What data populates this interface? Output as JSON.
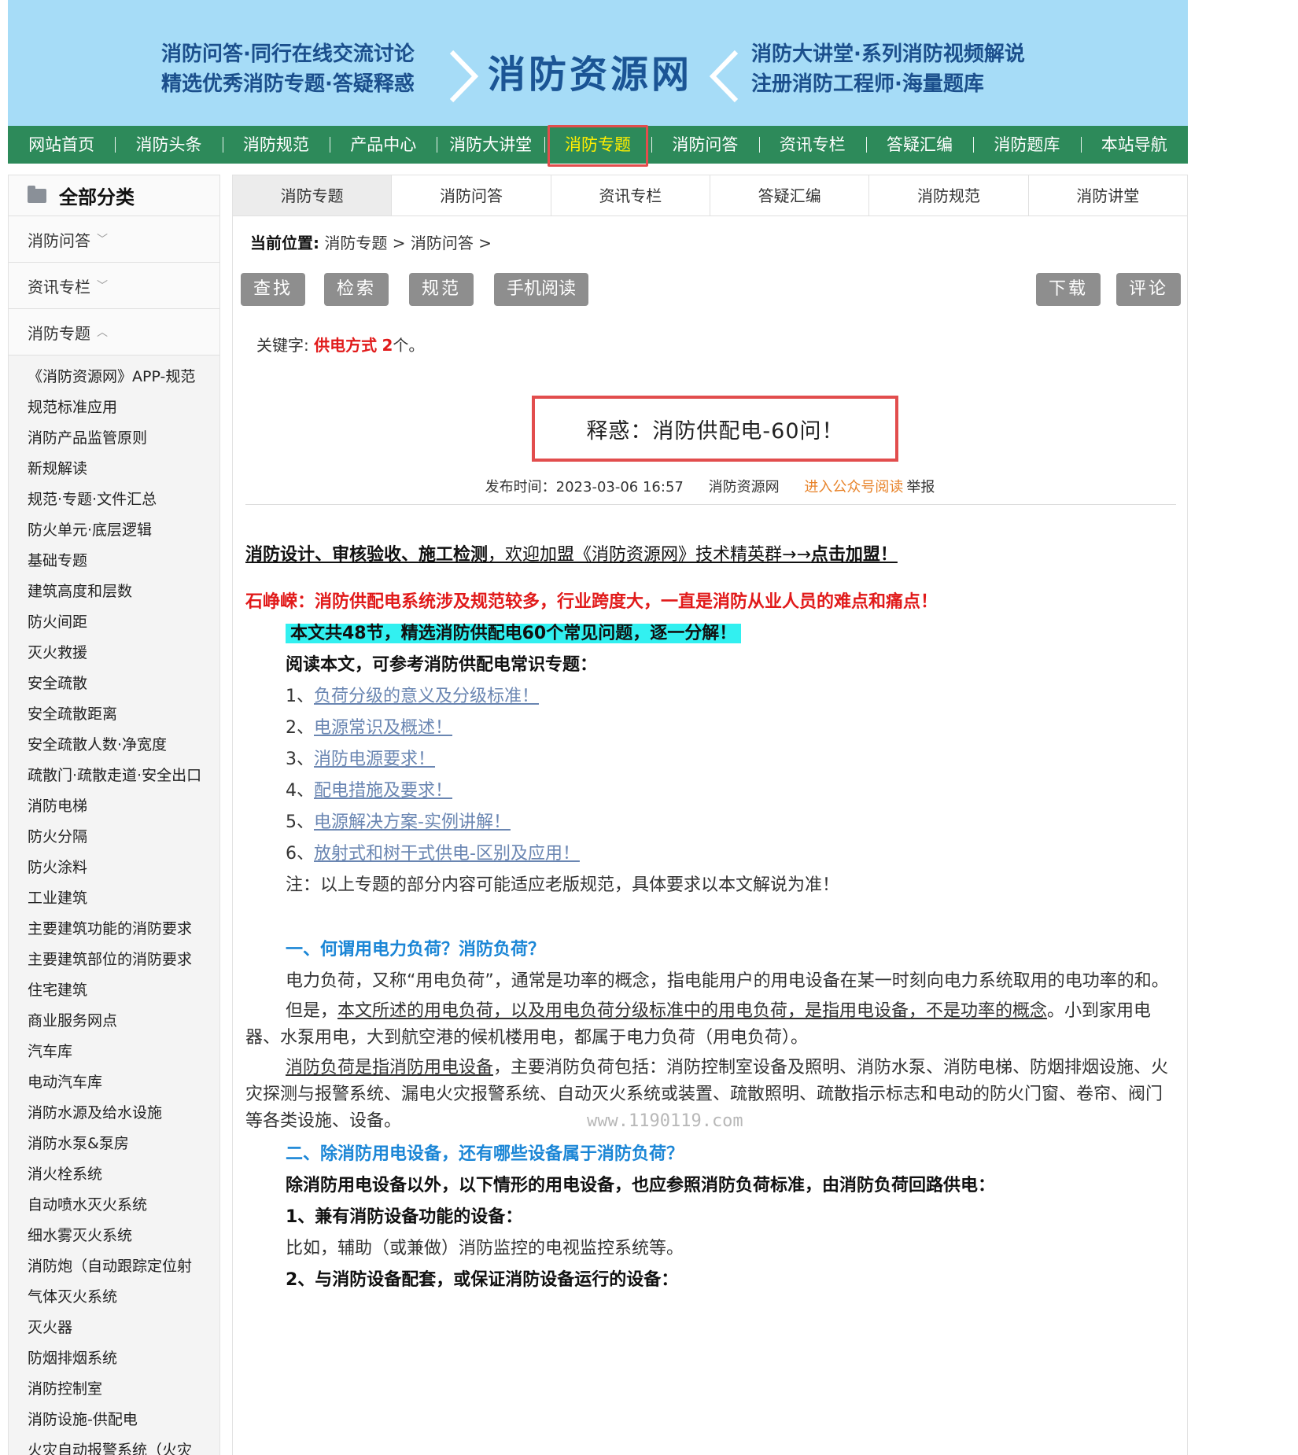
{
  "banner": {
    "left_line1": "消防问答·同行在线交流讨论",
    "left_line2": "精选优秀消防专题·答疑释惑",
    "site_name": "消防资源网",
    "right_line1": "消防大讲堂·系列消防视频解说",
    "right_line2": "注册消防工程师·海量题库",
    "bg_color": "#a6dcf7"
  },
  "nav": {
    "items": [
      "网站首页",
      "消防头条",
      "消防规范",
      "产品中心",
      "消防大讲堂",
      "消防专题",
      "消防问答",
      "资讯专栏",
      "答疑汇编",
      "消防题库",
      "本站导航"
    ],
    "active": "消防专题",
    "bg_color": "#2d8a5a"
  },
  "sidebar": {
    "title": "全部分类",
    "cat1": "消防问答",
    "cat2": "资讯专栏",
    "cat3": "消防专题",
    "items": [
      "《消防资源网》APP-规范",
      "规范标准应用",
      "消防产品监管原则",
      "新规解读",
      "规范·专题·文件汇总",
      "防火单元·底层逻辑",
      "基础专题",
      "建筑高度和层数",
      "防火间距",
      "灭火救援",
      "安全疏散",
      "安全疏散距离",
      "安全疏散人数·净宽度",
      "疏散门·疏散走道·安全出口",
      "消防电梯",
      "防火分隔",
      "防火涂料",
      "工业建筑",
      "主要建筑功能的消防要求",
      "主要建筑部位的消防要求",
      "住宅建筑",
      "商业服务网点",
      "汽车库",
      "电动汽车库",
      "消防水源及给水设施",
      "消防水泵&泵房",
      "消火栓系统",
      "自动喷水灭火系统",
      "细水雾灭火系统",
      "消防炮（自动跟踪定位射",
      "气体灭火系统",
      "灭火器",
      "防烟排烟系统",
      "消防控制室",
      "消防设施-供配电",
      "火灾自动报警系统（火灾"
    ]
  },
  "tabs": [
    "消防专题",
    "消防问答",
    "资讯专栏",
    "答疑汇编",
    "消防规范",
    "消防讲堂"
  ],
  "breadcrumb": {
    "label": "当前位置:",
    "path": "消防专题 > 消防问答 >"
  },
  "toolbar": {
    "find": "查找",
    "search": "检索",
    "spec": "规范",
    "mobile": "手机阅读",
    "download": "下载",
    "comment": "评论"
  },
  "keyword": {
    "label": "关键字:",
    "word": "供电方式",
    "count": "2",
    "suffix": "个。"
  },
  "article": {
    "title": "释惑：消防供配电-60问！",
    "publish_label": "发布时间：2023-03-06 16:57",
    "source": "消防资源网",
    "wechat": "进入公众号阅读",
    "report": "举报",
    "join_bold": "消防设计、审核验收、施工检测",
    "join_normal": "，欢迎加盟《消防资源网》技术精英群→→",
    "join_cta": "点击加盟！",
    "red_intro": "石峥嵘：消防供配电系统涉及规范较多，行业跨度大，一直是消防从业人员的难点和痛点！",
    "highlight": "本文共48节，精选消防供配电60个常见问题，逐一分解！",
    "read_ref": "阅读本文，可参考消防供配电常识专题：",
    "refs": [
      {
        "num": "1、",
        "text": "负荷分级的意义及分级标准！"
      },
      {
        "num": "2、",
        "text": "电源常识及概述！"
      },
      {
        "num": "3、",
        "text": "消防电源要求！"
      },
      {
        "num": "4、",
        "text": "配电措施及要求！"
      },
      {
        "num": "5、",
        "text": "电源解决方案-实例讲解！"
      },
      {
        "num": "6、",
        "text": "放射式和树干式供电-区别及应用！"
      }
    ],
    "note": "注：以上专题的部分内容可能适应老版规范，具体要求以本文解说为准！",
    "sec1_title": "一、何谓用电力负荷？消防负荷？",
    "sec1_p1": "电力负荷，又称“用电负荷”，通常是功率的概念，指电能用户的用电设备在某一时刻向电力系统取用的电功率的和。",
    "sec1_p2_a": "但是，",
    "sec1_p2_u": "本文所述的用电负荷，以及用电负荷分级标准中的用电负荷，是指用电设备，不是功率的概念",
    "sec1_p2_b": "。小到家用电器、水泵用电，大到航空港的候机楼用电，都属于电力负荷（用电负荷）。",
    "sec1_p3_u": "消防负荷是指消防用电设备",
    "sec1_p3_a": "，主要消防负荷包括：消防控制室设备及照明、消防水泵、消防电梯、防烟排烟设施、火灾探测与报警系统、漏电火灾报警系统、自动灭火系统或装置、疏散照明、疏散指示标志和电动的防火门窗、卷帘、阀门等各类设施、设备。",
    "watermark": "www.1190119.com",
    "sec2_title": "二、除消防用电设备，还有哪些设备属于消防负荷？",
    "sec2_p1": "除消防用电设备以外，以下情形的用电设备，也应参照消防负荷标准，由消防负荷回路供电：",
    "sec2_item1": "1、兼有消防设备功能的设备：",
    "sec2_item1_desc": "比如，辅助（或兼做）消防监控的电视监控系统等。",
    "sec2_item2": "2、与消防设备配套，或保证消防设备运行的设备："
  }
}
